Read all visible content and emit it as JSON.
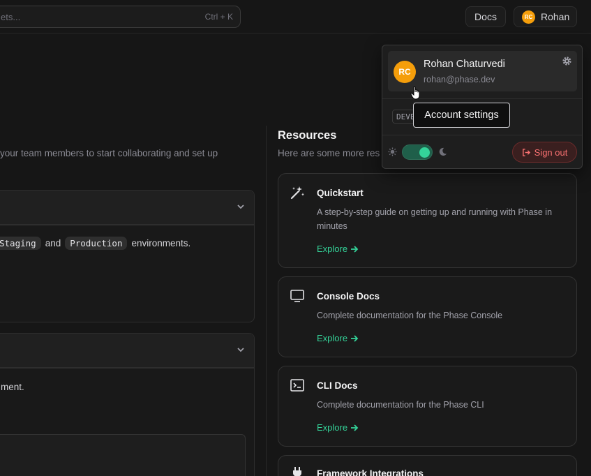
{
  "topbar": {
    "search_placeholder": "ets...",
    "search_shortcut": "Ctrl + K",
    "docs_label": "Docs",
    "user_initials": "RC",
    "user_label": "Rohan"
  },
  "left": {
    "intro": "your team members to start collaborating and set up",
    "panel1": {
      "env_staging": "Staging",
      "env_and": "and",
      "env_production": "Production",
      "env_suffix": "environments."
    },
    "panel2": {
      "text": "ment."
    }
  },
  "resources": {
    "title": "Resources",
    "subtitle": "Here are some more res",
    "cards": [
      {
        "title": "Quickstart",
        "desc": "A step-by-step guide on getting up and running with Phase in minutes",
        "link": "Explore",
        "icon": "magic-wand-icon"
      },
      {
        "title": "Console Docs",
        "desc": "Complete documentation for the Phase Console",
        "link": "Explore",
        "icon": "monitor-icon"
      },
      {
        "title": "CLI Docs",
        "desc": "Complete documentation for the Phase CLI",
        "link": "Explore",
        "icon": "terminal-icon"
      },
      {
        "title": "Framework Integrations",
        "icon": "plug-icon"
      }
    ]
  },
  "dropdown": {
    "initials": "RC",
    "name": "Rohan Chaturvedi",
    "email": "rohan@phase.dev",
    "badge": "DEVE",
    "signout": "Sign out",
    "tooltip": "Account settings",
    "theme_dark": true
  },
  "colors": {
    "accent": "#34d399",
    "avatar": "#f59e0b",
    "danger": "#f87171",
    "background": "#161616"
  }
}
